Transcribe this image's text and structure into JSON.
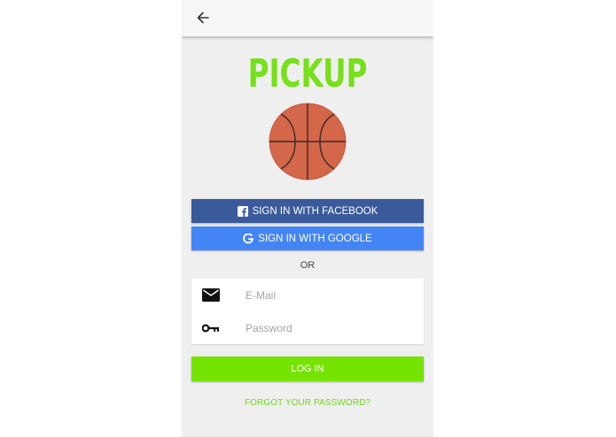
{
  "app": {
    "logo_text": "PICKUP",
    "logo_color": "#76e01a",
    "logo_icon": "basketball-icon"
  },
  "appbar": {
    "back_icon": "arrow-left-icon"
  },
  "social": {
    "facebook_label": "SIGN IN WITH FACEBOOK",
    "facebook_icon": "facebook-icon",
    "facebook_color": "#3a5a9b",
    "google_label": "SIGN IN WITH GOOGLE",
    "google_icon": "google-icon",
    "google_color": "#4385f4"
  },
  "divider": {
    "or_label": "OR"
  },
  "form": {
    "email_placeholder": "E-Mail",
    "email_value": "",
    "email_icon": "envelope-icon",
    "password_placeholder": "Password",
    "password_value": "",
    "password_icon": "key-icon"
  },
  "actions": {
    "login_label": "LOG IN",
    "login_color": "#76e402",
    "forgot_label": "FORGOT YOUR PASSWORD?"
  }
}
